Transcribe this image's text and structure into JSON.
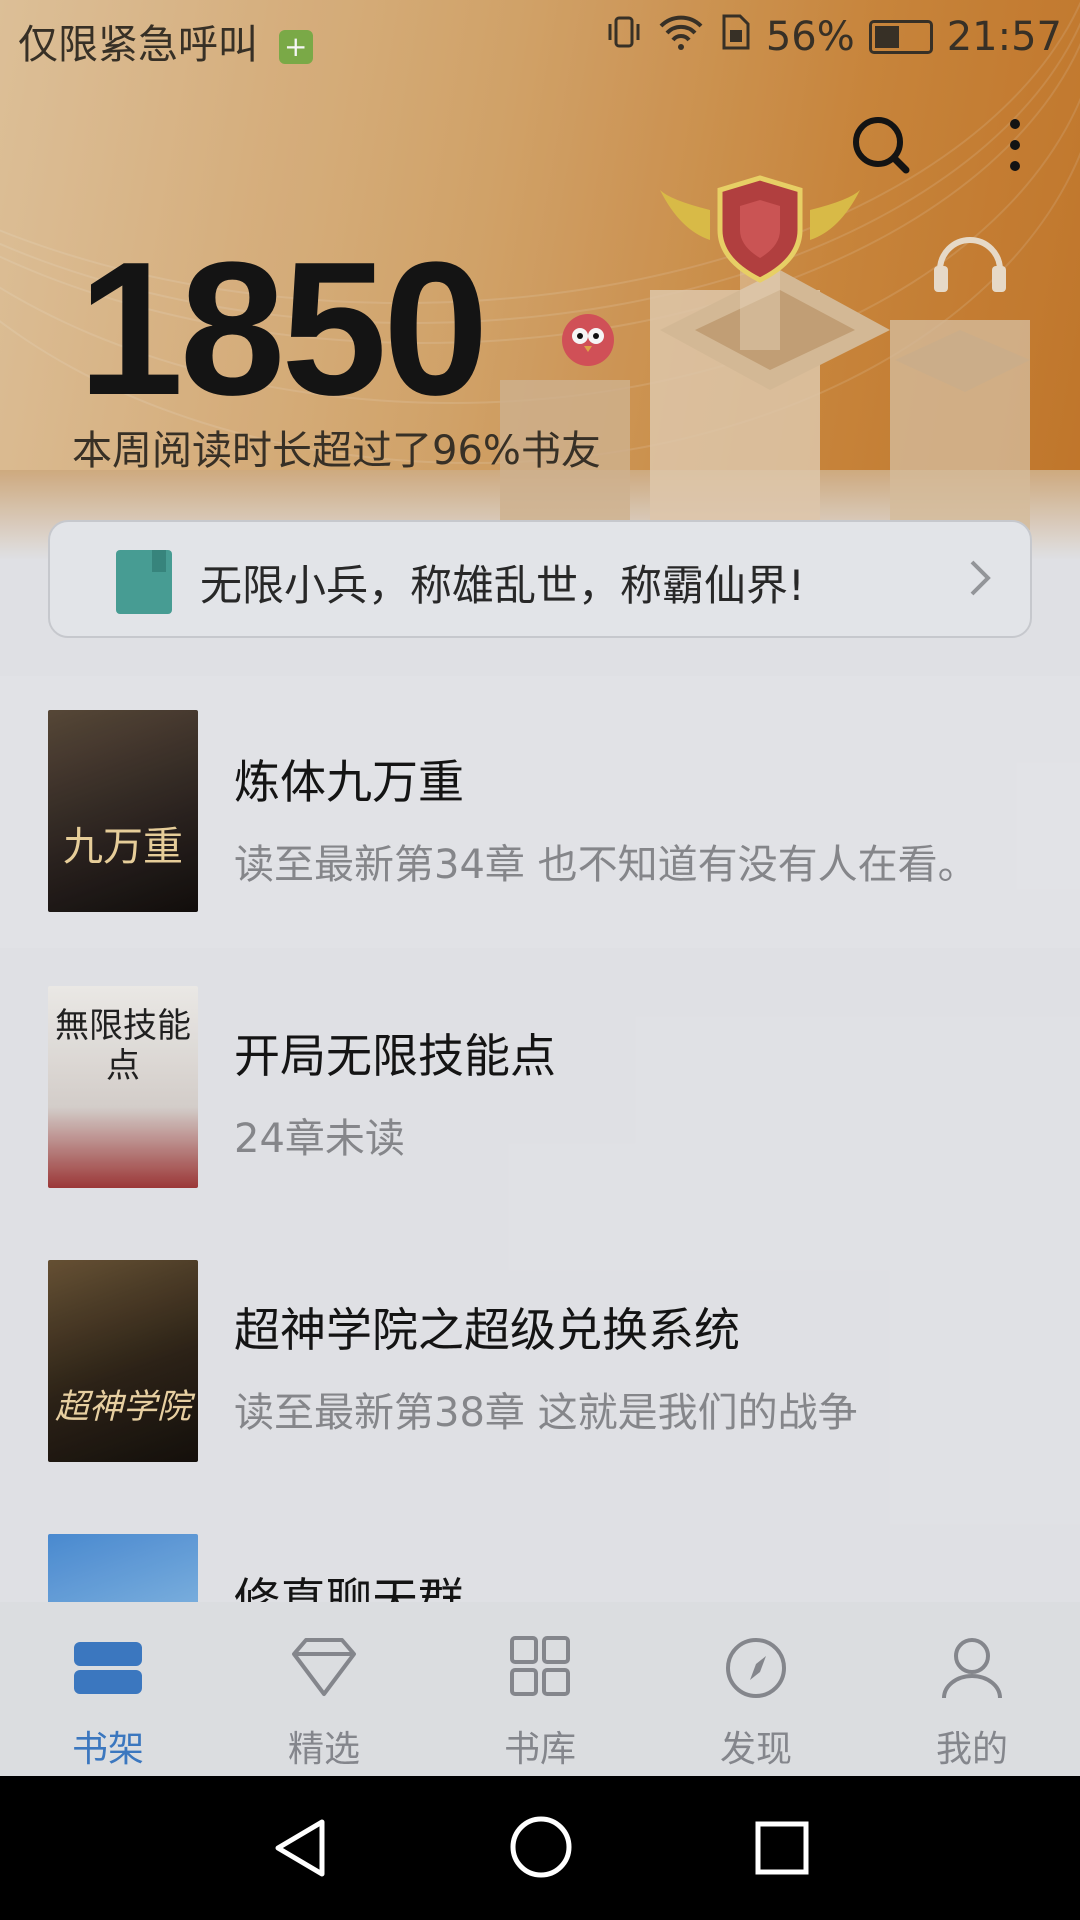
{
  "status_bar": {
    "carrier": "仅限紧急呼叫",
    "battery_percent": "56%",
    "time": "21:57"
  },
  "header": {
    "reading_score": "1850",
    "reading_subtitle": "本周阅读时长超过了96%书友"
  },
  "notice": {
    "text": "无限小兵，称雄乱世，称霸仙界!"
  },
  "books": [
    {
      "title": "炼体九万重",
      "progress": "读至最新第34章 也不知道有没有人在看。",
      "cover_text": "九万重"
    },
    {
      "title": "开局无限技能点",
      "progress": "24章未读",
      "cover_text": "無限技能点"
    },
    {
      "title": "超神学院之超级兑换系统",
      "progress": "读至最新第38章 这就是我们的战争",
      "cover_text": "超神学院"
    },
    {
      "title": "修真聊天群",
      "progress": "",
      "cover_text": ""
    }
  ],
  "tabs": [
    {
      "label": "书架",
      "icon": "bookshelf-icon",
      "active": true
    },
    {
      "label": "精选",
      "icon": "diamond-icon",
      "active": false
    },
    {
      "label": "书库",
      "icon": "grid-icon",
      "active": false
    },
    {
      "label": "发现",
      "icon": "compass-icon",
      "active": false
    },
    {
      "label": "我的",
      "icon": "user-icon",
      "active": false
    }
  ],
  "colors": {
    "accent": "#3e7cc7",
    "hero_gold": "#d9a86c"
  }
}
